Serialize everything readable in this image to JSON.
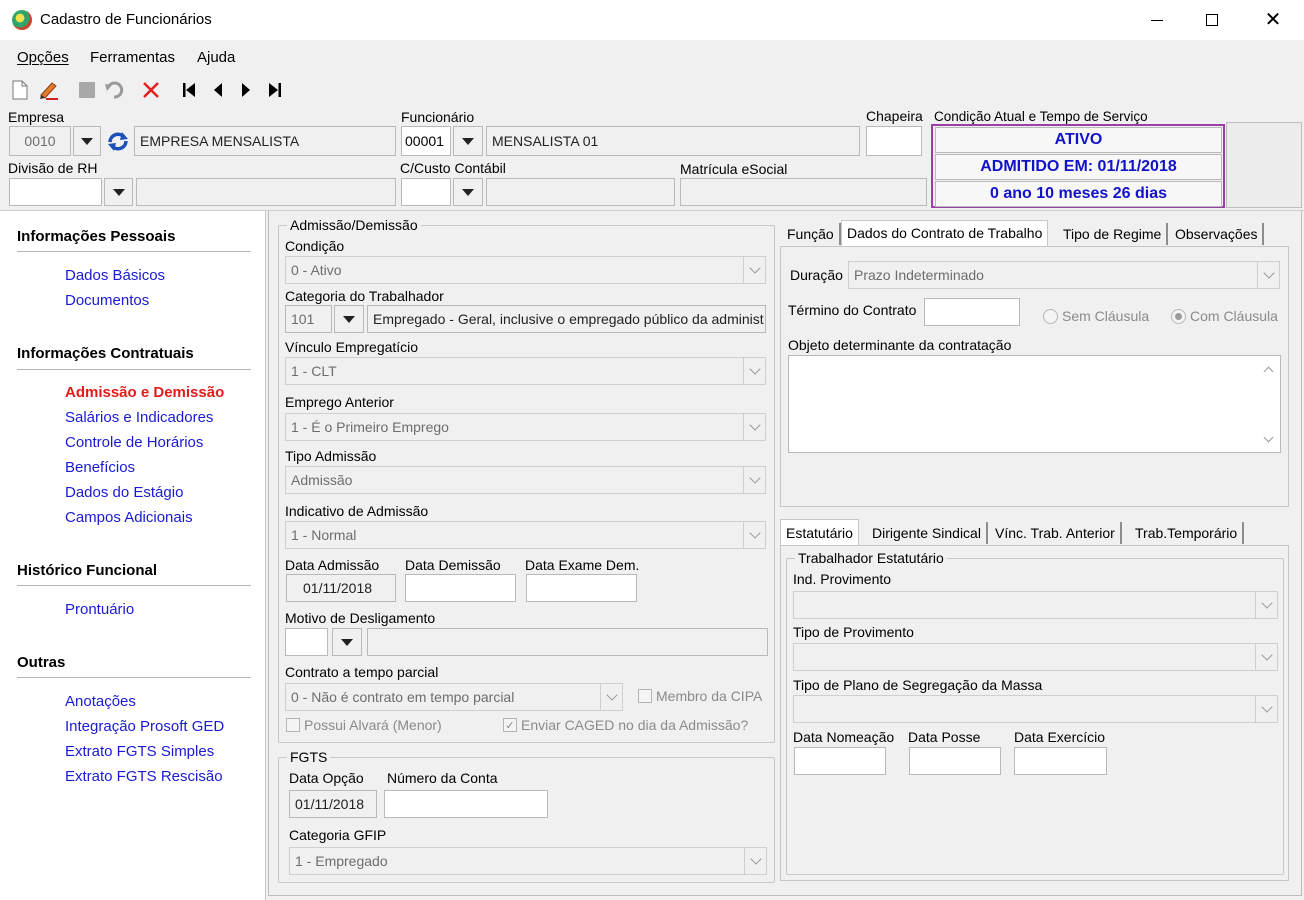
{
  "window": {
    "title": "Cadastro de Funcionários"
  },
  "menu": [
    "Opções",
    "Ferramentas",
    "Ajuda"
  ],
  "header": {
    "empresa_label": "Empresa",
    "empresa_code": "0010",
    "empresa_name": "EMPRESA MENSALISTA",
    "funcionario_label": "Funcionário",
    "funcionario_code": "00001",
    "funcionario_name": "MENSALISTA 01",
    "chapeira_label": "Chapeira",
    "condicao_label": "Condição Atual e Tempo de Serviço",
    "status": "ATIVO",
    "admitido": "ADMITIDO EM: 01/11/2018",
    "tempo": "0 ano 10 meses 26 dias",
    "divisao_label": "Divisão de RH",
    "ccusto_label": "C/Custo Contábil",
    "matricula_label": "Matrícula eSocial"
  },
  "sidebar": {
    "sections": [
      {
        "title": "Informações Pessoais",
        "items": [
          "Dados Básicos",
          "Documentos"
        ]
      },
      {
        "title": "Informações Contratuais",
        "items": [
          "Admissão e Demissão",
          "Salários e Indicadores",
          "Controle de Horários",
          "Benefícios",
          "Dados do Estágio",
          "Campos Adicionais"
        ]
      },
      {
        "title": "Histórico Funcional",
        "items": [
          "Prontuário"
        ]
      },
      {
        "title": "Outras",
        "items": [
          "Anotações",
          "Integração Prosoft GED",
          "Extrato FGTS Simples",
          "Extrato FGTS Rescisão"
        ]
      }
    ]
  },
  "admissao": {
    "group_title": "Admissão/Demissão",
    "condicao_label": "Condição",
    "condicao_value": "0 - Ativo",
    "categoria_label": "Categoria do Trabalhador",
    "categoria_code": "101",
    "categoria_desc": "Empregado - Geral, inclusive o empregado público da administ",
    "vinculo_label": "Vínculo Empregatício",
    "vinculo_value": "1 - CLT",
    "emprego_label": "Emprego Anterior",
    "emprego_value": "1 - É o Primeiro Emprego",
    "tipo_label": "Tipo Admissão",
    "tipo_value": "Admissão",
    "indicativo_label": "Indicativo de Admissão",
    "indicativo_value": "1 - Normal",
    "data_adm_label": "Data Admissão",
    "data_adm_value": "01/11/2018",
    "data_dem_label": "Data Demissão",
    "data_exame_label": "Data Exame Dem.",
    "motivo_label": "Motivo de Desligamento",
    "contrato_label": "Contrato a tempo parcial",
    "contrato_value": "0 - Não é contrato em tempo parcial",
    "membro_cipa": "Membro da CIPA",
    "alvara": "Possui Alvará (Menor)",
    "caged": "Enviar CAGED no dia da Admissão?"
  },
  "fgts": {
    "group_title": "FGTS",
    "data_opcao_label": "Data Opção",
    "data_opcao_value": "01/11/2018",
    "numero_conta_label": "Número da Conta",
    "categoria_label": "Categoria GFIP",
    "categoria_value": "1 - Empregado"
  },
  "contrato_tabs": [
    "Função",
    "Dados do Contrato de Trabalho",
    "Tipo de Regime",
    "Observações"
  ],
  "contrato": {
    "duracao_label": "Duração",
    "duracao_value": "Prazo Indeterminado",
    "termino_label": "Término do Contrato",
    "sem_clausula": "Sem Cláusula",
    "com_clausula": "Com Cláusula",
    "objeto_label": "Objeto determinante da contratação"
  },
  "estatutario_tabs": [
    "Estatutário",
    "Dirigente Sindical",
    "Vínc. Trab. Anterior",
    "Trab.Temporário"
  ],
  "estatutario": {
    "group_title": "Trabalhador Estatutário",
    "ind_label": "Ind. Provimento",
    "tipo_label": "Tipo de Provimento",
    "plano_label": "Tipo de Plano de Segregação da Massa",
    "nomeacao_label": "Data Nomeação",
    "posse_label": "Data Posse",
    "exercicio_label": "Data Exercício"
  },
  "colors": {
    "link": "#1a1ad4",
    "active_link": "#e21b1b",
    "status_text": "#1212c8",
    "status_border": "#9b3fa6"
  }
}
